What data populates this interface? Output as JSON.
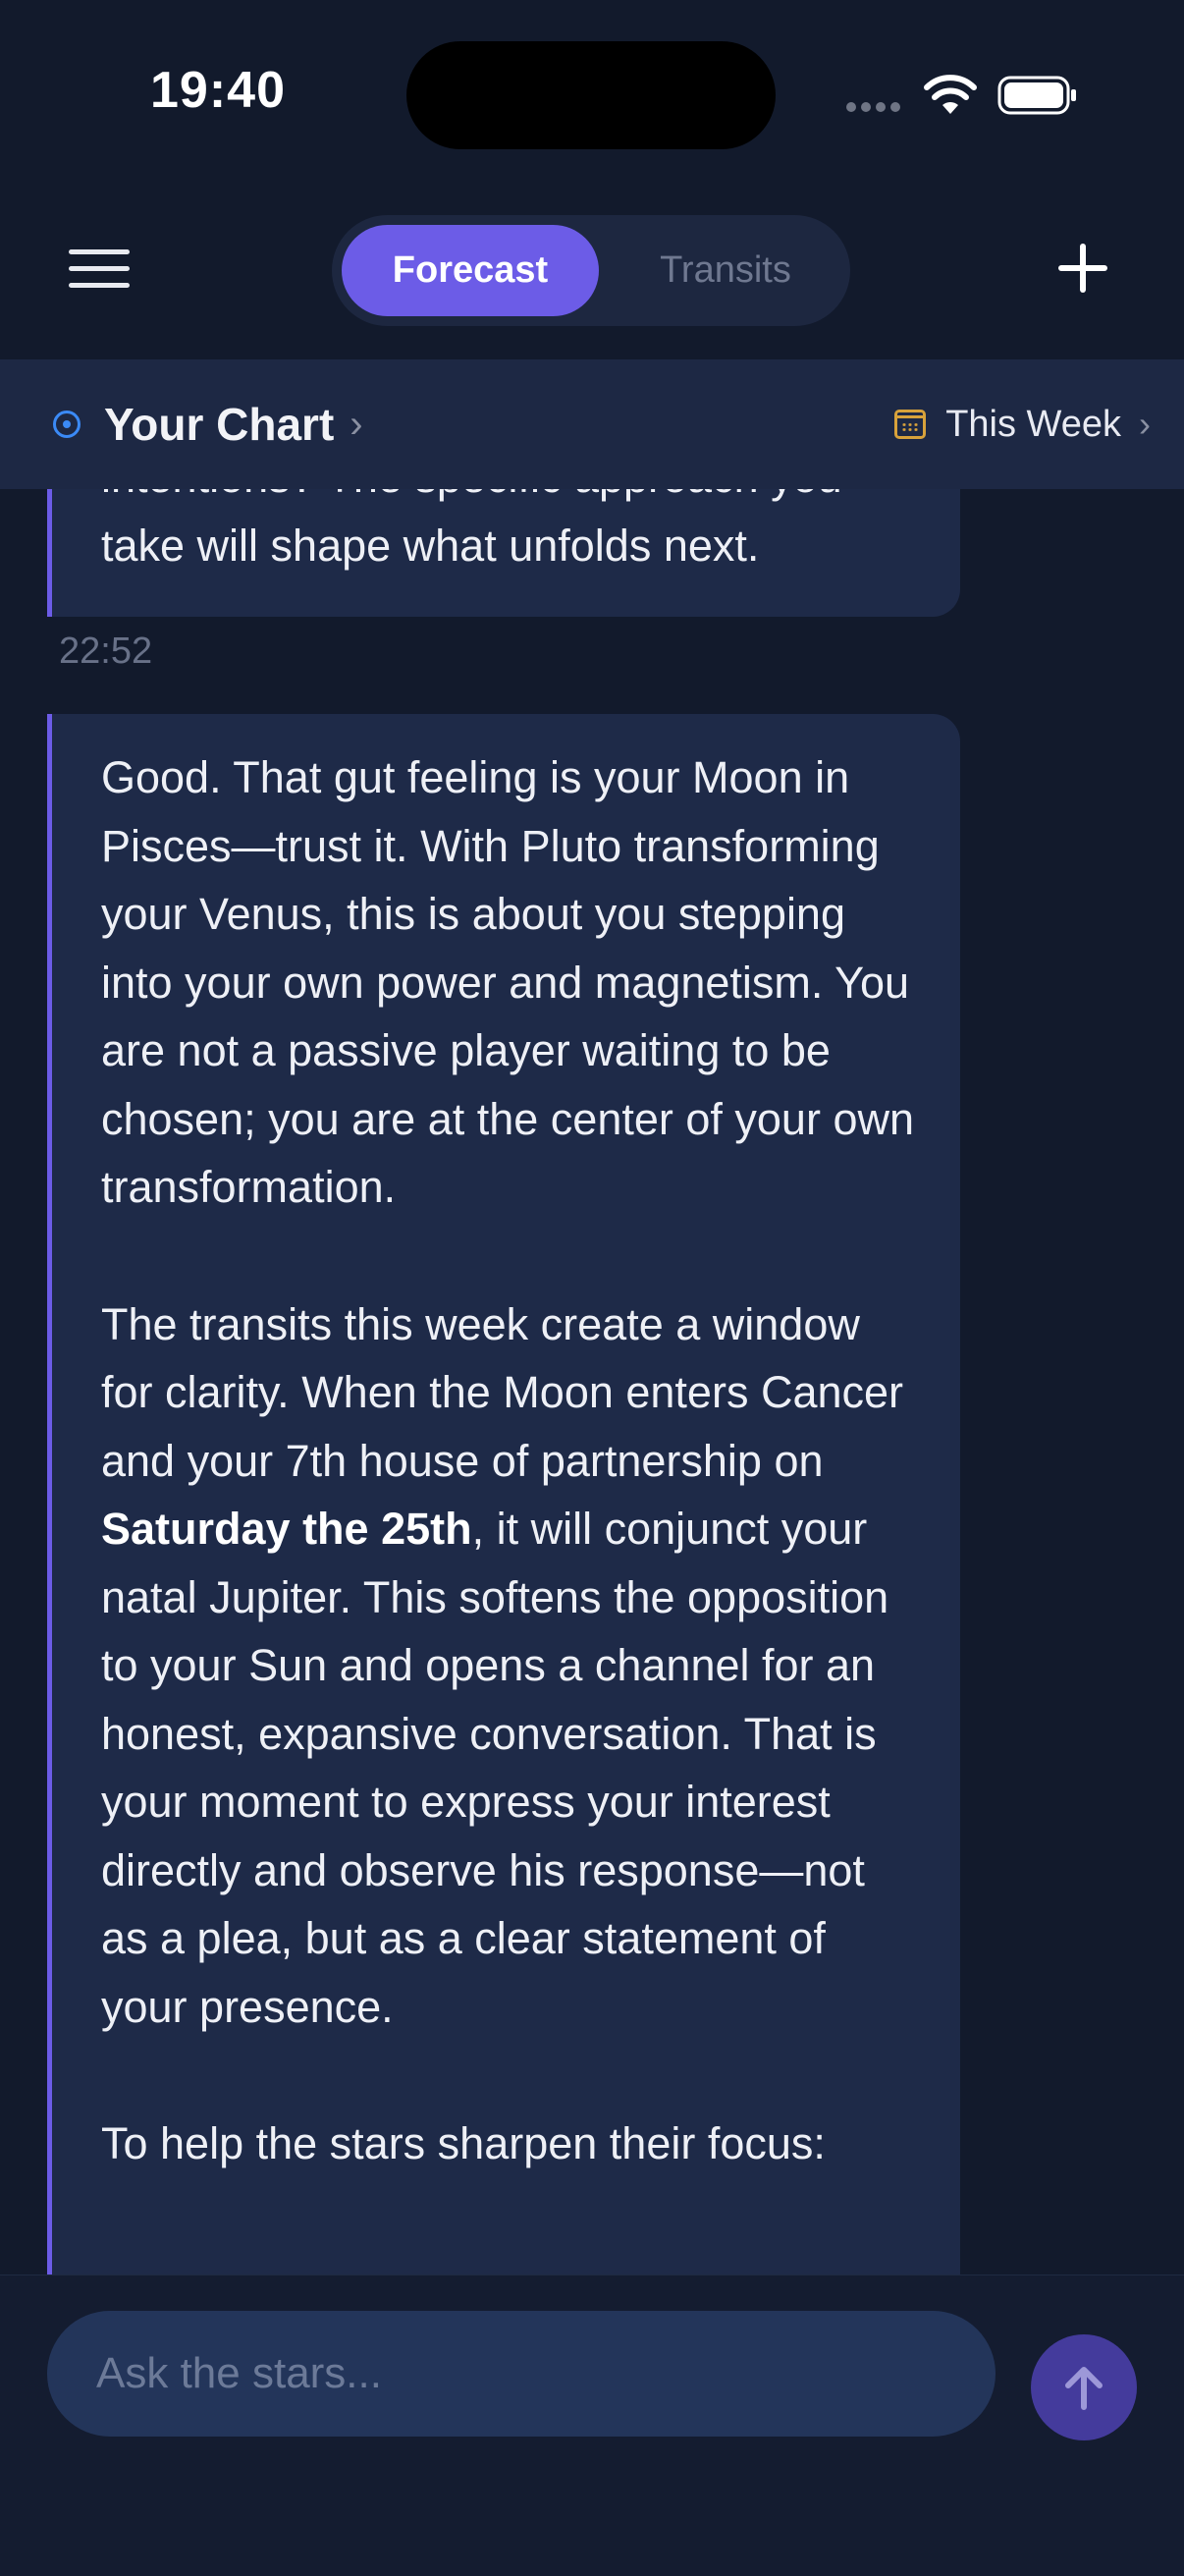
{
  "status_bar": {
    "time": "19:40"
  },
  "nav": {
    "tabs": [
      {
        "label": "Forecast",
        "active": true
      },
      {
        "label": "Transits",
        "active": false
      }
    ]
  },
  "context_bar": {
    "chart_label": "Your Chart",
    "period_label": "This Week"
  },
  "messages": [
    {
      "lines": [
        "intentions? The specific approach you",
        "take will shape what unfolds next."
      ],
      "timestamp": "22:52"
    },
    {
      "p1": "Good. That gut feeling is your Moon in Pisces—trust it. With Pluto transforming your Venus, this is about you stepping into your own power and magnetism. You are not a passive player waiting to be chosen; you are at the center of your own transformation.",
      "p2_before": "The transits this week create a window for clarity. When the Moon enters Cancer and your 7th house of partnership on ",
      "p2_bold": "Saturday the 25th",
      "p2_after": ", it will conjunct your natal Jupiter. This softens the opposition to your Sun and opens a channel for an honest, expansive conversation. That is your moment to express your interest directly and observe his response—not as a plea, but as a clear statement of your presence.",
      "p3": "To help the stars sharpen their focus:"
    }
  ],
  "composer": {
    "placeholder": "Ask the stars..."
  },
  "colors": {
    "accent": "#6c5ce7",
    "background": "#121a2c",
    "bubble": "#1e2a48",
    "target_icon": "#3b8af6",
    "calendar_icon": "#d8a23b",
    "send_button": "#443b9c"
  },
  "icons": [
    "menu-icon",
    "plus-icon",
    "target-icon",
    "calendar-icon",
    "chevron-right-icon",
    "arrow-up-icon",
    "wifi-icon",
    "battery-icon"
  ]
}
